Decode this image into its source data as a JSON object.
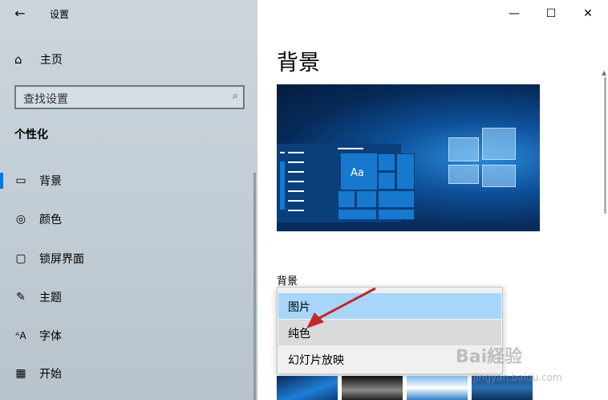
{
  "window": {
    "title": "设置",
    "back_icon": "back-arrow-icon",
    "min_icon": "—",
    "max_icon": "☐",
    "close_icon": "✕"
  },
  "sidebar": {
    "home_label": "主页",
    "home_icon": "home-icon",
    "search_placeholder": "查找设置",
    "section_title": "个性化",
    "items": [
      {
        "label": "背景",
        "icon": "picture-icon",
        "selected": true
      },
      {
        "label": "颜色",
        "icon": "palette-icon",
        "selected": false
      },
      {
        "label": "锁屏界面",
        "icon": "lock-screen-icon",
        "selected": false
      },
      {
        "label": "主题",
        "icon": "theme-brush-icon",
        "selected": false
      },
      {
        "label": "字体",
        "icon": "font-icon",
        "selected": false
      },
      {
        "label": "开始",
        "icon": "start-grid-icon",
        "selected": false
      }
    ]
  },
  "main": {
    "page_title": "背景",
    "background_label": "背景",
    "preview_tile_text": "Aa",
    "dropdown": {
      "options": [
        "图片",
        "纯色",
        "幻灯片放映"
      ],
      "selected": "图片",
      "hovered": "纯色"
    }
  },
  "overlay": {
    "watermark": "Bai経验",
    "watermark_sub": "jingyan.baidu.com"
  },
  "colors": {
    "accent": "#0078d7",
    "selected_option": "#a8d6fb",
    "arrow": "#c0282b"
  }
}
